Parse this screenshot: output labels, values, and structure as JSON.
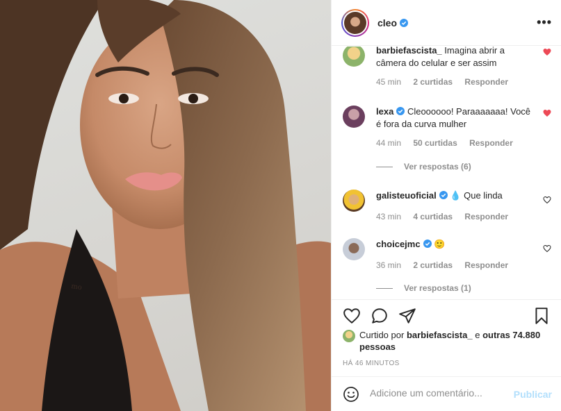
{
  "post": {
    "username": "cleo",
    "verified": true,
    "more_label": "•••"
  },
  "comments": [
    {
      "username": "barbiefascista_",
      "text": "Imagina abrir a câmera do celular e ser assim",
      "time": "45 min",
      "likes": "2 curtidas",
      "reply": "Responder",
      "liked": true,
      "verified": false
    },
    {
      "username": "lexa",
      "text": "Cleoooooo! Paraaaaaaa! Você é fora da curva mulher",
      "time": "44 min",
      "likes": "50 curtidas",
      "reply": "Responder",
      "liked": true,
      "verified": true,
      "view_replies": "Ver respostas (6)"
    },
    {
      "username": "galisteuoficial",
      "text": "💧 Que linda",
      "time": "43 min",
      "likes": "4 curtidas",
      "reply": "Responder",
      "liked": false,
      "verified": true
    },
    {
      "username": "choicejmc",
      "text": "🙂",
      "time": "36 min",
      "likes": "2 curtidas",
      "reply": "Responder",
      "liked": false,
      "verified": true,
      "view_replies": "Ver respostas (1)"
    }
  ],
  "likes_line": {
    "prefix": "Curtido por",
    "user": "barbiefascista_",
    "connector": "e",
    "others": "outras 74.880 pessoas"
  },
  "time_ago": "HÁ 46 MINUTOS",
  "comment_box": {
    "placeholder": "Adicione um comentário...",
    "publish_label": "Publicar"
  },
  "icons": {
    "like": "heart-outline-icon",
    "comment": "comment-bubble-icon",
    "share": "paper-plane-icon",
    "save": "bookmark-icon",
    "emoji": "emoji-icon"
  },
  "colors": {
    "liked_heart": "#ed4956",
    "verified": "#3897f0",
    "publish_disabled": "#b2dffc",
    "muted": "#8e8e8e"
  }
}
